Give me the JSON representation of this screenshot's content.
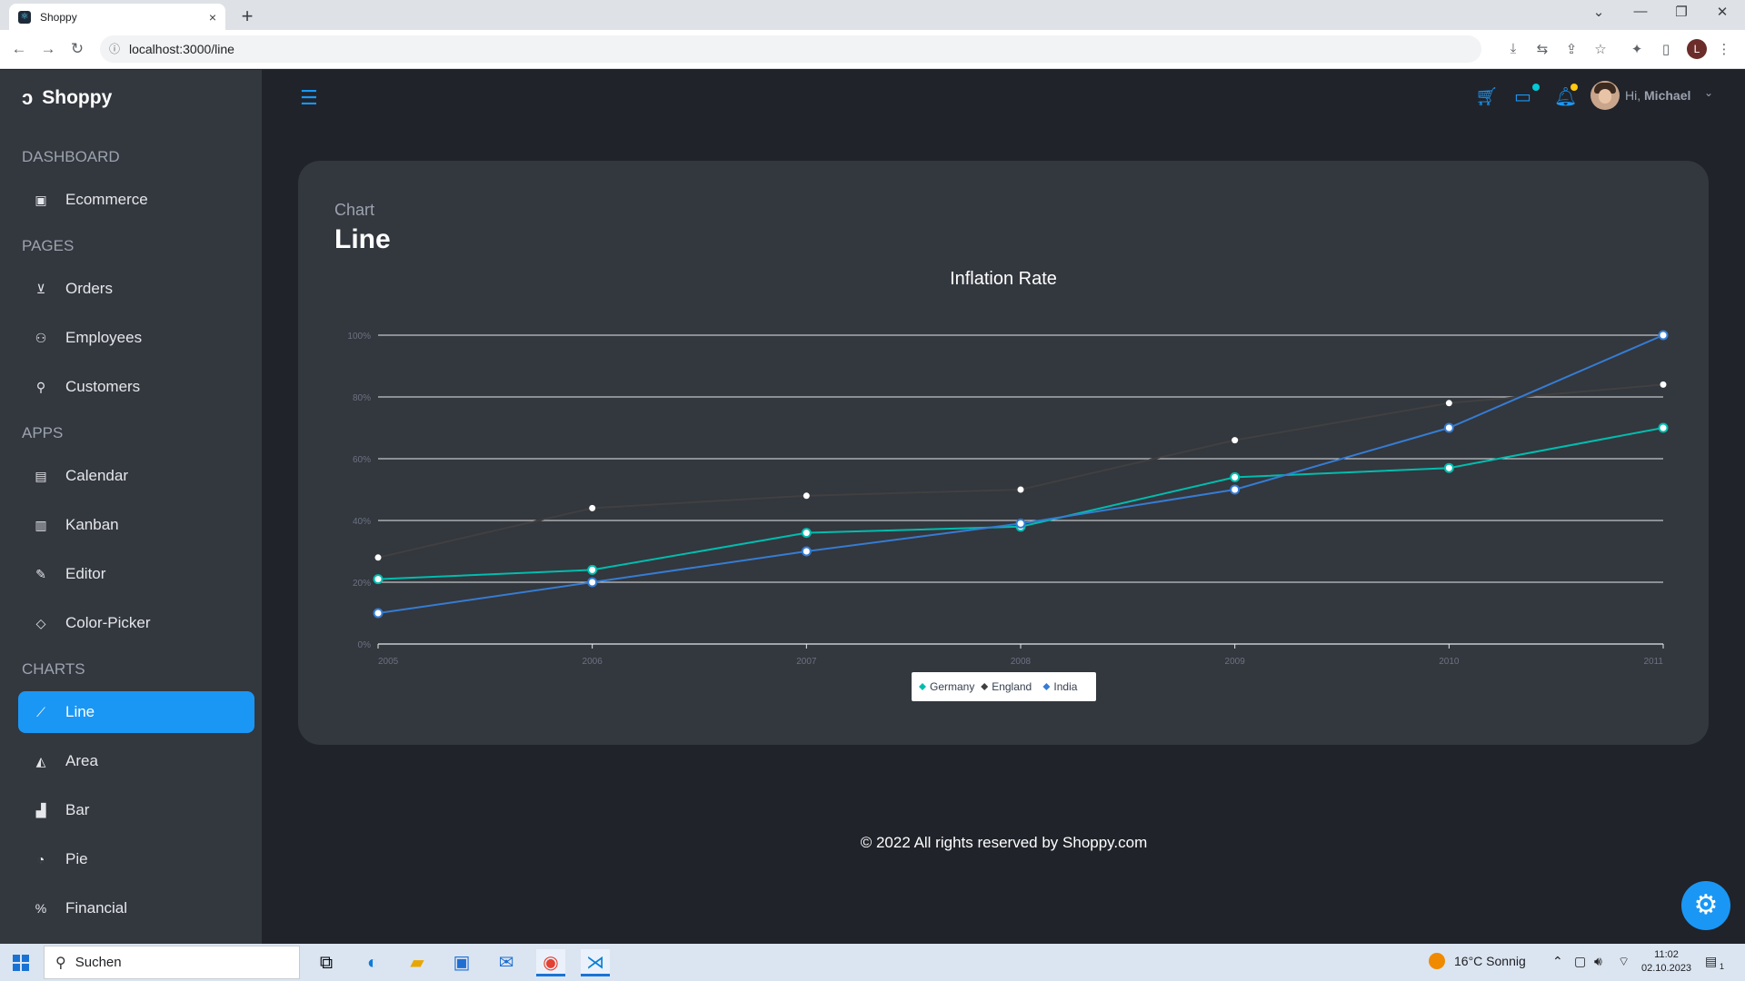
{
  "browser": {
    "tab_title": "Shoppy",
    "tab_close": "×",
    "new_tab": "+",
    "url": "localhost:3000/line",
    "profile_initial": "L"
  },
  "app": {
    "brand": "Shoppy",
    "sections": [
      {
        "title": "DASHBOARD",
        "items": [
          {
            "label": "Ecommerce",
            "icon": "bag-icon"
          }
        ]
      },
      {
        "title": "PAGES",
        "items": [
          {
            "label": "Orders",
            "icon": "cart-icon"
          },
          {
            "label": "Employees",
            "icon": "people-icon"
          },
          {
            "label": "Customers",
            "icon": "user-list-icon"
          }
        ]
      },
      {
        "title": "APPS",
        "items": [
          {
            "label": "Calendar",
            "icon": "calendar-icon"
          },
          {
            "label": "Kanban",
            "icon": "kanban-icon"
          },
          {
            "label": "Editor",
            "icon": "edit-icon"
          },
          {
            "label": "Color-Picker",
            "icon": "color-picker-icon"
          }
        ]
      },
      {
        "title": "CHARTS",
        "items": [
          {
            "label": "Line",
            "icon": "line-chart-icon"
          },
          {
            "label": "Area",
            "icon": "area-chart-icon"
          },
          {
            "label": "Bar",
            "icon": "bar-chart-icon"
          },
          {
            "label": "Pie",
            "icon": "pie-chart-icon"
          },
          {
            "label": "Financial",
            "icon": "financial-icon"
          }
        ]
      }
    ],
    "user": {
      "hi": "Hi,",
      "name": "Michael"
    },
    "accent": "#1a97f5"
  },
  "page": {
    "category": "Chart",
    "title": "Line"
  },
  "chart_data": {
    "type": "line",
    "title": "Inflation Rate",
    "x": [
      "2005",
      "2006",
      "2007",
      "2008",
      "2009",
      "2010",
      "2011"
    ],
    "ylim": [
      0,
      100
    ],
    "yticks": [
      "0%",
      "20%",
      "40%",
      "60%",
      "80%",
      "100%"
    ],
    "series": [
      {
        "name": "Germany",
        "color": "#00bdae",
        "values": [
          21,
          24,
          36,
          38,
          54,
          57,
          70
        ]
      },
      {
        "name": "England",
        "color": "#404041",
        "values": [
          28,
          44,
          48,
          50,
          66,
          78,
          84
        ]
      },
      {
        "name": "India",
        "color": "#357cd2",
        "values": [
          10,
          20,
          30,
          39,
          50,
          70,
          100
        ]
      }
    ],
    "grid": true,
    "legend": "bottom-center"
  },
  "footer": "© 2022 All rights reserved by Shoppy.com",
  "taskbar": {
    "search": "Suchen",
    "weather": "16°C  Sonnig",
    "time": "11:02",
    "date": "02.10.2023",
    "notification_count": "1"
  }
}
